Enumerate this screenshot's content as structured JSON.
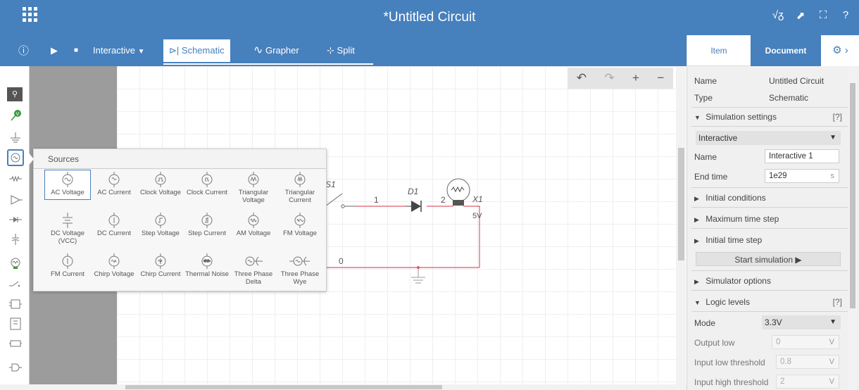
{
  "app": {
    "title": "*Untitled Circuit"
  },
  "titlebar_icons": [
    "√ᵹ",
    "⬈",
    "⛶",
    "?"
  ],
  "toolbar": {
    "info_icon": "ⓘ",
    "play_icon": "▶",
    "stop_icon": "■",
    "mode_label": "Interactive",
    "mode_caret": "▼",
    "tabs": [
      {
        "label": "Schematic",
        "icon": "⊳|"
      },
      {
        "label": "Grapher",
        "icon": "∿"
      },
      {
        "label": "Split",
        "icon": "⊹"
      }
    ]
  },
  "zoom": {
    "undo": "↶",
    "redo": "↷",
    "zoom_in": "+",
    "zoom_out": "−"
  },
  "palette": {
    "search_icon": "⚲",
    "items": [
      "probe",
      "ground",
      "source",
      "resistor",
      "diode-arrow",
      "diode",
      "capacitor",
      "lamp",
      "switch",
      "ic-1",
      "ic-2",
      "ic-3",
      "logic-gate"
    ]
  },
  "sources_popup": {
    "title": "Sources",
    "items": [
      {
        "label": "AC Voltage",
        "selected": true
      },
      {
        "label": "AC Current"
      },
      {
        "label": "Clock Voltage"
      },
      {
        "label": "Clock Current"
      },
      {
        "label": "Triangular Voltage"
      },
      {
        "label": "Triangular Current"
      },
      {
        "label": "DC Voltage (VCC)"
      },
      {
        "label": "DC Current"
      },
      {
        "label": "Step Voltage"
      },
      {
        "label": "Step Current"
      },
      {
        "label": "AM Voltage"
      },
      {
        "label": "FM Voltage"
      },
      {
        "label": "FM Current"
      },
      {
        "label": "Chirp Voltage"
      },
      {
        "label": "Chirp Current"
      },
      {
        "label": "Thermal Noise"
      },
      {
        "label": "Three Phase Delta"
      },
      {
        "label": "Three Phase Wye"
      }
    ]
  },
  "circuit": {
    "switch_label": "S1",
    "diode_label": "D1",
    "lamp_label": "X1",
    "lamp_rating": "5V",
    "net_1": "1",
    "net_2": "2",
    "net_0": "0",
    "wire_color": "#e05a6a"
  },
  "right_panel": {
    "tabs": {
      "item": "Item",
      "document": "Document",
      "gear": "⚙ ›"
    },
    "name_label": "Name",
    "name_value": "Untitled Circuit",
    "type_label": "Type",
    "type_value": "Schematic",
    "sim_settings": "Simulation settings",
    "help": "[?]",
    "sim_type": "Interactive",
    "sim_name_label": "Name",
    "sim_name_value": "Interactive 1",
    "end_time_label": "End time",
    "end_time_value": "1e29",
    "end_time_unit": "s",
    "initial_conditions": "Initial conditions",
    "max_time_step": "Maximum time step",
    "initial_time_step": "Initial time step",
    "start_sim": "Start simulation ▶",
    "simulator_options": "Simulator options",
    "logic_levels": "Logic levels",
    "mode_label": "Mode",
    "mode_value": "3.3V",
    "output_low_label": "Output low",
    "output_low_value": "0",
    "input_low_label": "Input low threshold",
    "input_low_value": "0.8",
    "input_high_label": "Input high threshold",
    "input_high_value": "2",
    "volt_unit": "V",
    "collapsed_arrow": "▶",
    "expanded_arrow": "▼"
  },
  "colors": {
    "header_blue": "#4680bd",
    "panel_bg": "#f0f0f0"
  }
}
